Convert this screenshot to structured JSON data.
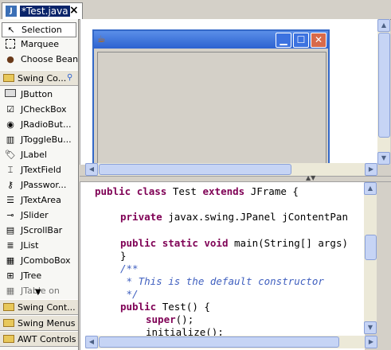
{
  "editor": {
    "tab_label": "*Test.java",
    "tab_icon": "J",
    "close_glyph": "×"
  },
  "palette": {
    "selection": "Selection",
    "marquee": "Marquee",
    "choose_bean": "Choose Bean",
    "category_swing_components": "Swing Co...",
    "items": [
      {
        "label": "JButton"
      },
      {
        "label": "JCheckBox"
      },
      {
        "label": "JRadioBut..."
      },
      {
        "label": "JToggleBu..."
      },
      {
        "label": "JLabel"
      },
      {
        "label": "JTextField"
      },
      {
        "label": "JPasswor..."
      },
      {
        "label": "JTextArea"
      },
      {
        "label": "JSlider"
      },
      {
        "label": "JScrollBar"
      },
      {
        "label": "JList"
      },
      {
        "label": "JComboBox"
      },
      {
        "label": "JTree"
      },
      {
        "label": "JTable on"
      }
    ],
    "category_swing_containers": "Swing Cont...",
    "category_swing_menus": "Swing Menus",
    "category_awt_controls": "AWT Controls"
  },
  "design": {
    "frame_icon": "☕"
  },
  "code": {
    "l1_kw1": "public",
    "l1_kw2": "class",
    "l1_name": "Test",
    "l1_kw3": "extends",
    "l1_rest": "JFrame {",
    "l2_kw": "private",
    "l2_rest": "javax.swing.JPanel jContentPan",
    "l3_kw1": "public",
    "l3_kw2": "static",
    "l3_kw3": "void",
    "l3_rest": "main(String[] args)",
    "l4": "}",
    "l5": "/**",
    "l6": " * This is the default constructor",
    "l7": " */",
    "l8_kw": "public",
    "l8_rest": "Test() {",
    "l9_kw": "super",
    "l9_rest": "();",
    "l10": "initialize();"
  },
  "colors": {
    "keyword": "#7f0055",
    "comment": "#3f5fbf",
    "tab_selected": "#0a246a",
    "titlebar": "#2d62d0"
  }
}
